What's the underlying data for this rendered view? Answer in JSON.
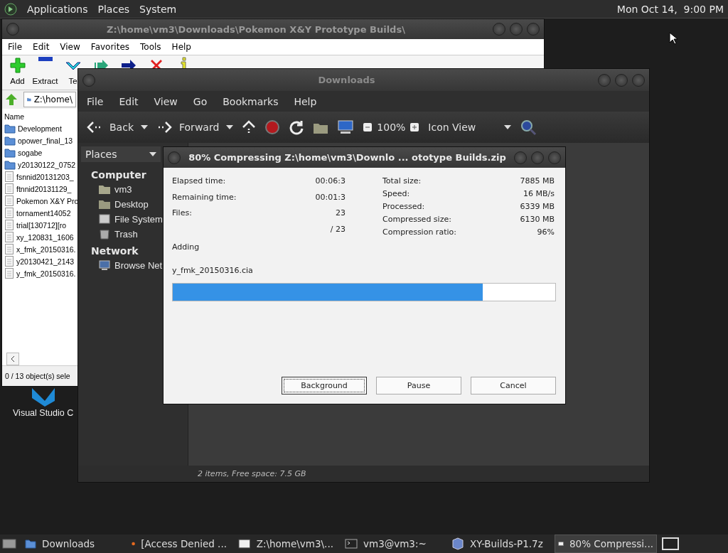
{
  "top_panel": {
    "menus": [
      "Applications",
      "Places",
      "System"
    ],
    "clock": "Mon Oct 14,  9:00 PM"
  },
  "desktop_icons": [
    {
      "label": "Visual Studio C"
    }
  ],
  "archive_window": {
    "title": "Z:\\home\\vm3\\Downloads\\Pokemon X&Y Prototype Builds\\",
    "menu": [
      "File",
      "Edit",
      "View",
      "Favorites",
      "Tools",
      "Help"
    ],
    "toolbar": [
      {
        "kind": "add",
        "label": "Add"
      },
      {
        "kind": "extract",
        "label": "Extract"
      },
      {
        "kind": "test",
        "label": "Te"
      },
      {
        "kind": "copy"
      },
      {
        "kind": "move"
      },
      {
        "kind": "delete"
      },
      {
        "kind": "info"
      }
    ],
    "path": "Z:\\home\\",
    "column": "Name",
    "files": [
      {
        "name": "Development",
        "kind": "folder"
      },
      {
        "name": "opower_final_13",
        "kind": "folder"
      },
      {
        "name": "sogabe",
        "kind": "folder"
      },
      {
        "name": "y20130122_0752",
        "kind": "folder"
      },
      {
        "name": "fsnnid20131203_",
        "kind": "file"
      },
      {
        "name": "ftnnid20131129_",
        "kind": "file"
      },
      {
        "name": "Pokemon X&Y Pro",
        "kind": "file"
      },
      {
        "name": "tornament14052",
        "kind": "file"
      },
      {
        "name": "trial[130712][ro",
        "kind": "file"
      },
      {
        "name": "xy_120831_1606",
        "kind": "file"
      },
      {
        "name": "x_fmk_20150316.",
        "kind": "file"
      },
      {
        "name": "y20130421_2143",
        "kind": "file"
      },
      {
        "name": "y_fmk_20150316.",
        "kind": "file"
      }
    ],
    "status": "0 / 13 object(s) sele"
  },
  "file_manager": {
    "title": "Downloads",
    "menu": [
      "File",
      "Edit",
      "View",
      "Go",
      "Bookmarks",
      "Help"
    ],
    "toolbar": {
      "back": "Back",
      "forward": "Forward",
      "zoom": "100%",
      "view": "Icon View"
    },
    "places_header": "Places",
    "sections": [
      {
        "heading": "Computer",
        "items": [
          {
            "label": "vm3",
            "kind": "home"
          },
          {
            "label": "Desktop",
            "kind": "desktop"
          },
          {
            "label": "File System",
            "kind": "drive"
          },
          {
            "label": "Trash",
            "kind": "trash"
          }
        ]
      },
      {
        "heading": "Network",
        "items": [
          {
            "label": "Browse Net",
            "kind": "network"
          }
        ]
      }
    ],
    "status": "2 items, Free space: 7.5 GB"
  },
  "dialog": {
    "title": "80% Compressing Z:\\home\\vm3\\Downlo ... ototype Builds.zip",
    "left_stats": [
      {
        "label": "Elapsed time:",
        "value": "00:06:3"
      },
      {
        "label": "Remaining time:",
        "value": "00:01:3"
      },
      {
        "label": "Files:",
        "value": "23"
      },
      {
        "value": "/ 23"
      }
    ],
    "right_stats": [
      {
        "label": "Total size:",
        "value": "7885 MB"
      },
      {
        "label": "Speed:",
        "value": "16 MB/s"
      },
      {
        "label": "Processed:",
        "value": "6339 MB"
      },
      {
        "label": "Compressed size:",
        "value": "6130 MB"
      },
      {
        "label": "Compression ratio:",
        "value": "96%"
      }
    ],
    "action": "Adding",
    "current_file": "y_fmk_20150316.cia",
    "progress": {
      "level": 0.81
    },
    "buttons": [
      {
        "label": "Background",
        "focused": true
      },
      {
        "label": "Pause",
        "focused": false
      },
      {
        "label": "Cancel",
        "focused": false
      }
    ]
  },
  "taskbar": [
    {
      "label": "Downloads",
      "kind": "folder",
      "selected": false
    },
    {
      "label": "[Access Denied ...",
      "kind": "browser",
      "selected": false
    },
    {
      "label": "Z:\\home\\vm3\\...",
      "kind": "sevenzip",
      "selected": false
    },
    {
      "label": "vm3@vm3:~",
      "kind": "terminal",
      "selected": false
    },
    {
      "label": "XY-Builds-P1.7z",
      "kind": "archive",
      "selected": false
    },
    {
      "label": "80% Compressi...",
      "kind": "sevenzip",
      "selected": true
    }
  ]
}
